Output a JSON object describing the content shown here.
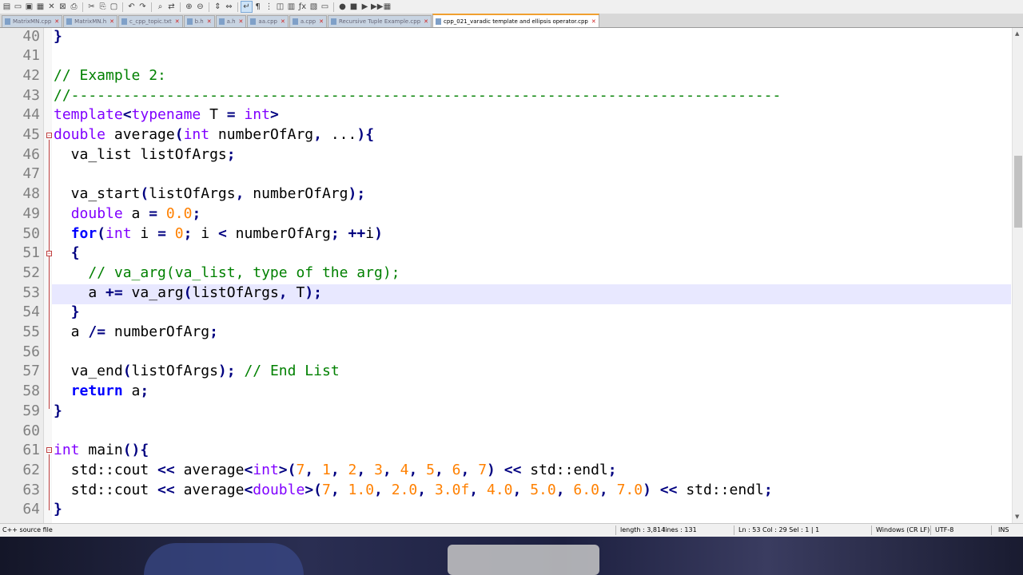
{
  "toolbar": {
    "icons": [
      "new-file-icon",
      "open-icon",
      "save-icon",
      "save-all-icon",
      "close-icon",
      "close-all-icon",
      "print-icon",
      "cut-icon",
      "copy-icon",
      "paste-icon",
      "undo-icon",
      "redo-icon",
      "find-icon",
      "replace-icon",
      "zoom-in-icon",
      "zoom-out-icon",
      "sync-v-icon",
      "sync-h-icon",
      "word-wrap-icon",
      "all-chars-icon",
      "indent-guide-icon",
      "udl-icon",
      "doc-map-icon",
      "function-list-icon",
      "folder-workspace-icon",
      "monitor-icon",
      "record-macro-icon",
      "stop-record-icon",
      "play-macro-icon",
      "run-macro-multiple-icon",
      "save-macro-icon"
    ]
  },
  "tabs": [
    {
      "label": "MatrixMN.cpp"
    },
    {
      "label": "MatrixMN.h"
    },
    {
      "label": "c_cpp_topic.txt"
    },
    {
      "label": "b.h"
    },
    {
      "label": "a.h"
    },
    {
      "label": "aa.cpp"
    },
    {
      "label": "a.cpp"
    },
    {
      "label": "Recursive Tuple Example.cpp"
    },
    {
      "label": "cpp_021_varadic template and ellipsis operator.cpp",
      "active": true
    }
  ],
  "editor": {
    "line_numbers": [
      "40",
      "41",
      "42",
      "43",
      "44",
      "45",
      "46",
      "47",
      "48",
      "49",
      "50",
      "51",
      "52",
      "53",
      "54",
      "55",
      "56",
      "57",
      "58",
      "59",
      "60",
      "61",
      "62",
      "63",
      "64"
    ],
    "current_line": "53",
    "lines": [
      "}",
      "",
      "// Example 2:",
      "//----------------------------------------------------------------------------------",
      "template<typename T = int>",
      "double average(int numberOfArg, ...){",
      "  va_list listOfArgs;",
      "",
      "  va_start(listOfArgs, numberOfArg);",
      "  double a = 0.0;",
      "  for(int i = 0; i < numberOfArg; ++i)",
      "  {",
      "    // va_arg(va_list, type of the arg);",
      "    a += va_arg(listOfArgs, T);",
      "  }",
      "  a /= numberOfArg;",
      "",
      "  va_end(listOfArgs); // End List",
      "  return a;",
      "}",
      "",
      "int main(){",
      "  std::cout << average<int>(7, 1, 2, 3, 4, 5, 6, 7) << std::endl;",
      "  std::cout << average<double>(7, 1.0, 2.0, 3.0f, 4.0, 5.0, 6.0, 7.0) << std::endl;",
      "}"
    ]
  },
  "status": {
    "file_type": "C++ source file",
    "length": "length : 3,814",
    "lines": "lines : 131",
    "position": "Ln : 53    Col : 29    Sel : 1 | 1",
    "eol": "Windows (CR LF)",
    "encoding": "UTF-8",
    "mode": "INS"
  },
  "colors": {
    "keyword": "#8000ff",
    "bold_keyword": "#0000ff",
    "number": "#ff8000",
    "comment": "#008000",
    "operator": "#000080",
    "current_line_bg": "#e8e8ff",
    "match_highlight": "#8cf08c"
  }
}
